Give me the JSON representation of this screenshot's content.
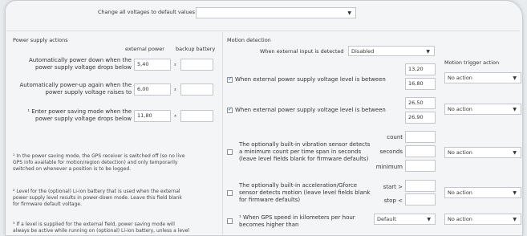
{
  "top": {
    "label": "Change all voltages to default values for",
    "select_value": ""
  },
  "power": {
    "title": "Power supply actions",
    "col_external": "external power",
    "col_backup": "backup battery",
    "rows": [
      {
        "line1": "Automatically power down when the",
        "line2": "power supply voltage drops below",
        "value": "5,40",
        "sup": "²",
        "backup": ""
      },
      {
        "line1": "Automatically power-up again when the",
        "line2": "power supply voltage raises to",
        "value": "6,00",
        "sup": "²",
        "backup": ""
      },
      {
        "line1": "¹ Enter power saving mode when the",
        "line2": "power supply voltage drops below",
        "value": "11,80",
        "sup": "³",
        "backup": ""
      }
    ],
    "note1": {
      "l1": "¹ In the power saving mode, the GPS receiver is switched off (so no live",
      "l2": "GPS info available for motion/region detection) and only temporarily",
      "l3": "switched on whenever a position is to be logged."
    },
    "note2": {
      "l1": "² Level for the (optional) Li-ion battery that is used when the external",
      "l2": "power supply level results in power-down mode. Leave this field blank",
      "l3": "for firmware default voltage."
    },
    "note3": {
      "l1": "³ If a level is supplied for the external field, power saving mode will",
      "l2": "always be active while running on (optional) Li-ion battery, unless a level"
    }
  },
  "motion": {
    "title": "Motion detection",
    "ext_label": "When external input is detected",
    "ext_value": "Disabled",
    "trigger_header": "Motion trigger action",
    "rows": [
      {
        "checked": true,
        "label": "When external power supply voltage level is between",
        "v1": "13,20",
        "v2": "16,80",
        "action": "No action"
      },
      {
        "checked": true,
        "label": "When external power supply voltage level is between",
        "v1": "26,50",
        "v2": "26,90",
        "action": "No action"
      }
    ],
    "vibration": {
      "l1": "The optionally built-in vibration sensor detects",
      "l2": "a minimum count per time span in seconds",
      "l3": "(leave level fields blank for firmware defaults)",
      "count": "count",
      "seconds": "seconds",
      "minimum": "minimum",
      "action": "No action"
    },
    "accel": {
      "l1": "The optionally built-in acceleration/Gforce",
      "l2": "sensor detects motion (leave level fields blank",
      "l3": "for firmware defaults)",
      "start": "start >",
      "stop": "stop <",
      "action": "No action"
    },
    "gps": {
      "l1": "¹  When GPS speed in kilometers per hour",
      "l2": "becomes higher than",
      "select": "Default",
      "action": "No action"
    }
  }
}
